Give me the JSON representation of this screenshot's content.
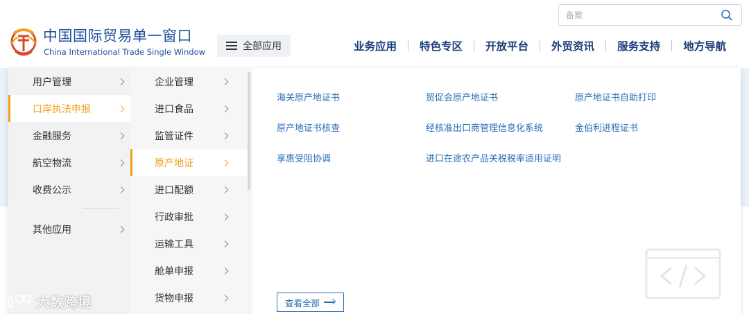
{
  "header": {
    "brand_cn": "中国国际贸易单一窗口",
    "brand_en": "China International Trade Single Window",
    "all_apps_label": "全部应用",
    "search": {
      "placeholder": "备案"
    },
    "nav": [
      "业务应用",
      "特色专区",
      "开放平台",
      "外贸资讯",
      "服务支持",
      "地方导航"
    ]
  },
  "menu": {
    "level1": [
      {
        "label": "用户管理",
        "active": false
      },
      {
        "label": "口岸执法申报",
        "active": true
      },
      {
        "label": "金融服务",
        "active": false
      },
      {
        "label": "航空物流",
        "active": false
      },
      {
        "label": "收费公示",
        "active": false
      },
      {
        "label": "其他应用",
        "active": false
      }
    ],
    "level2": [
      {
        "label": "企业管理",
        "active": false
      },
      {
        "label": "进口食品",
        "active": false
      },
      {
        "label": "监管证件",
        "active": false
      },
      {
        "label": "原产地证",
        "active": true
      },
      {
        "label": "进口配额",
        "active": false
      },
      {
        "label": "行政审批",
        "active": false
      },
      {
        "label": "运输工具",
        "active": false
      },
      {
        "label": "舱单申报",
        "active": false
      },
      {
        "label": "货物申报",
        "active": false
      }
    ],
    "links": [
      "海关原产地证书",
      "贸促会原产地证书",
      "原产地证书自助打印",
      "原产地证书核查",
      "经核准出口商管理信息化系统",
      "金伯利进程证书",
      "享惠受阻协调",
      "进口在途农产品关税税率适用证明"
    ],
    "view_all": "查看全部"
  },
  "watermark": "大数跨境",
  "colors": {
    "brand_blue": "#1f4f9c",
    "nav_blue": "#1c3d7a",
    "link_blue": "#2b6db8",
    "accent_orange": "#f2a01c"
  },
  "icons": [
    "logo-emblem",
    "hamburger-icon",
    "search-icon",
    "chevron-right-icon",
    "arrow-right-icon",
    "code-brackets-icon"
  ]
}
